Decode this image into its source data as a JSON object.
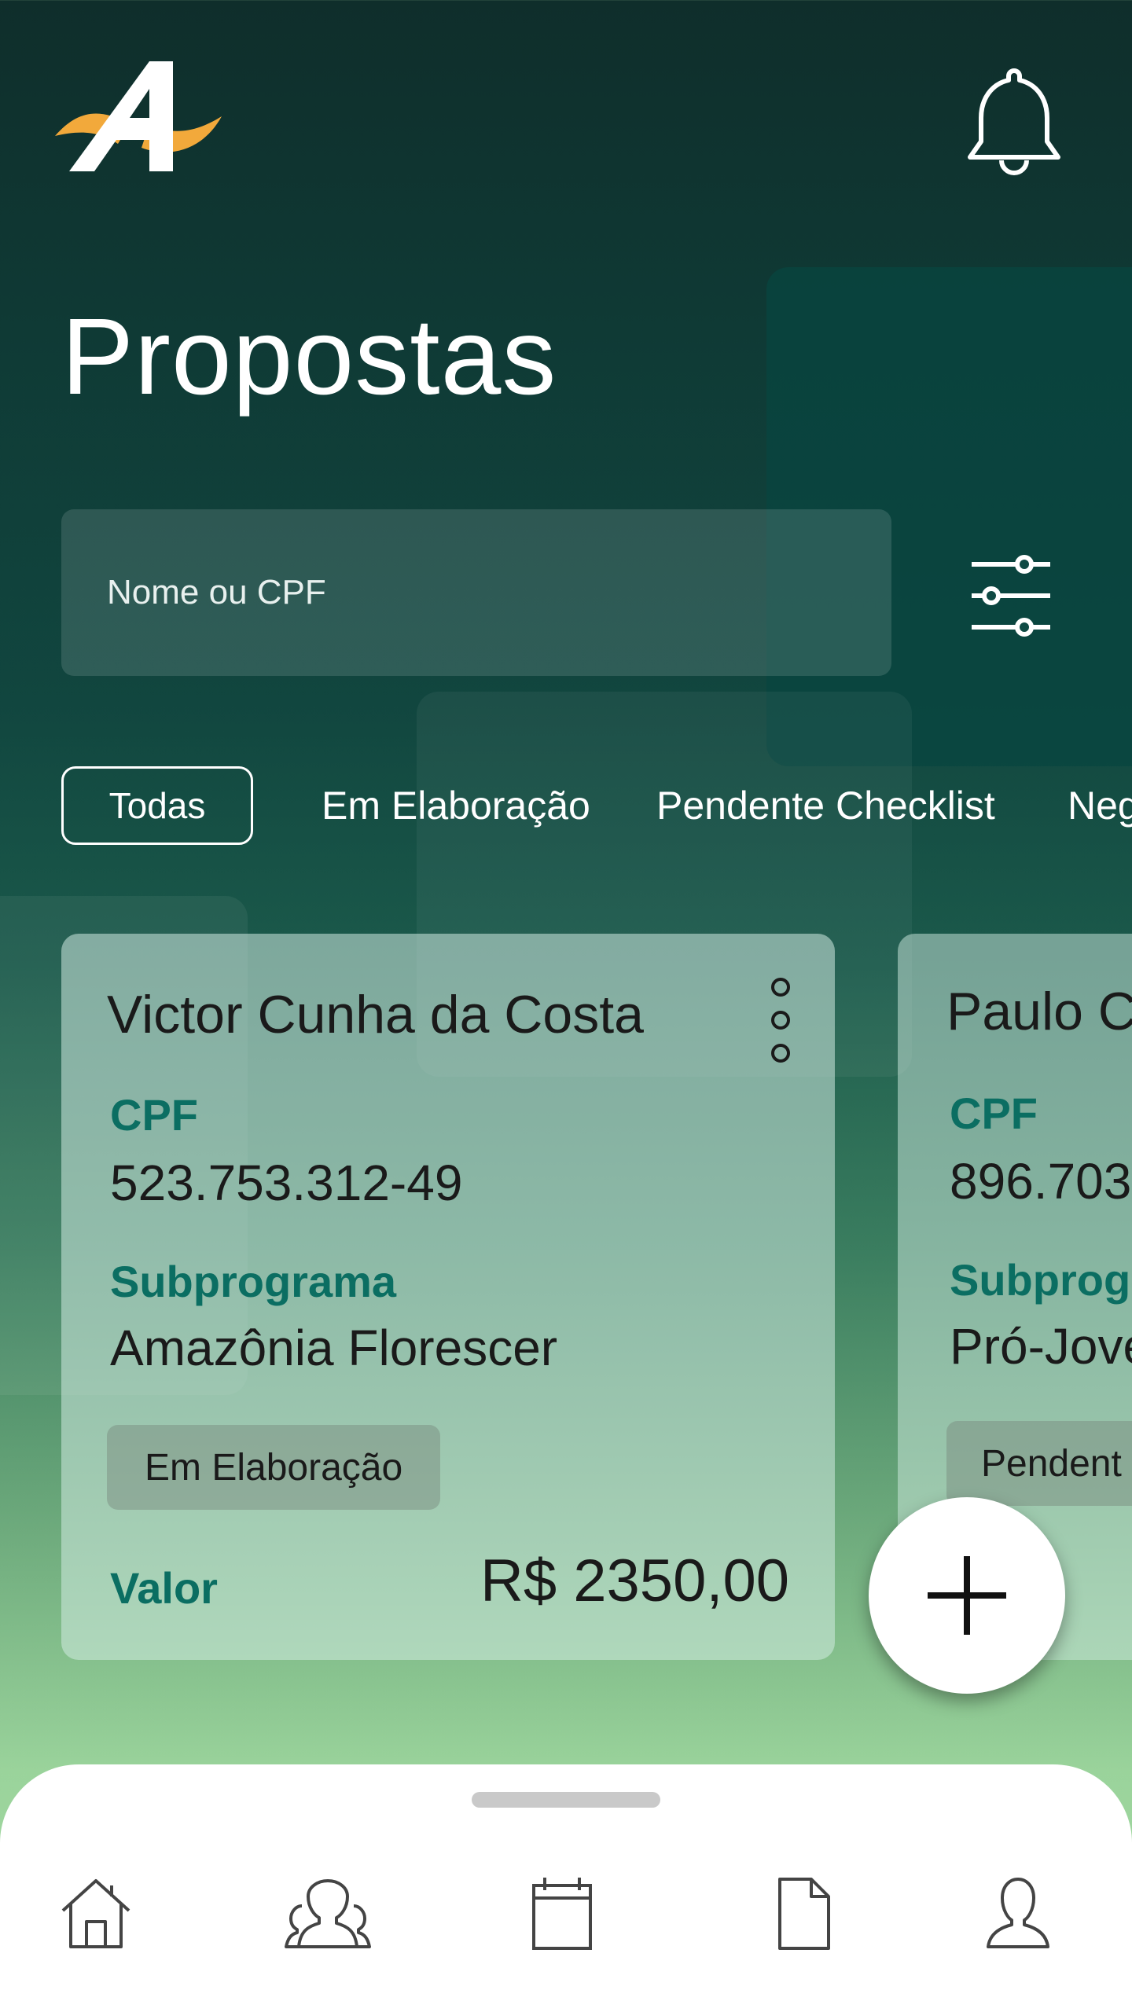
{
  "app": {
    "title": "Propostas"
  },
  "header": {
    "logo_icon": "app-logo-icon",
    "notification_icon": "bell-icon"
  },
  "search": {
    "placeholder": "Nome ou CPF",
    "filter_icon": "sliders-icon"
  },
  "filters": [
    {
      "label": "Todas",
      "active": true
    },
    {
      "label": "Em Elaboração",
      "active": false
    },
    {
      "label": "Pendente Checklist",
      "active": false
    },
    {
      "label": "Neg",
      "active": false
    }
  ],
  "cards": [
    {
      "name": "Victor Cunha da Costa",
      "cpf_label": "CPF",
      "cpf": "523.753.312-49",
      "subprograma_label": "Subprograma",
      "subprograma": "Amazônia Florescer",
      "status": "Em Elaboração",
      "valor_label": "Valor",
      "valor": "R$ 2350,00"
    },
    {
      "name": "Paulo C",
      "cpf_label": "CPF",
      "cpf": "896.703",
      "subprograma_label": "Subprog",
      "subprograma": "Pró-Jove",
      "status": "Pendent"
    }
  ],
  "fab": {
    "icon": "plus-icon"
  },
  "bottom_nav": [
    "home-icon",
    "people-icon",
    "calendar-icon",
    "document-icon",
    "profile-icon"
  ],
  "colors": {
    "accent": "#0b6e62",
    "logo_orange": "#f2a93b"
  }
}
